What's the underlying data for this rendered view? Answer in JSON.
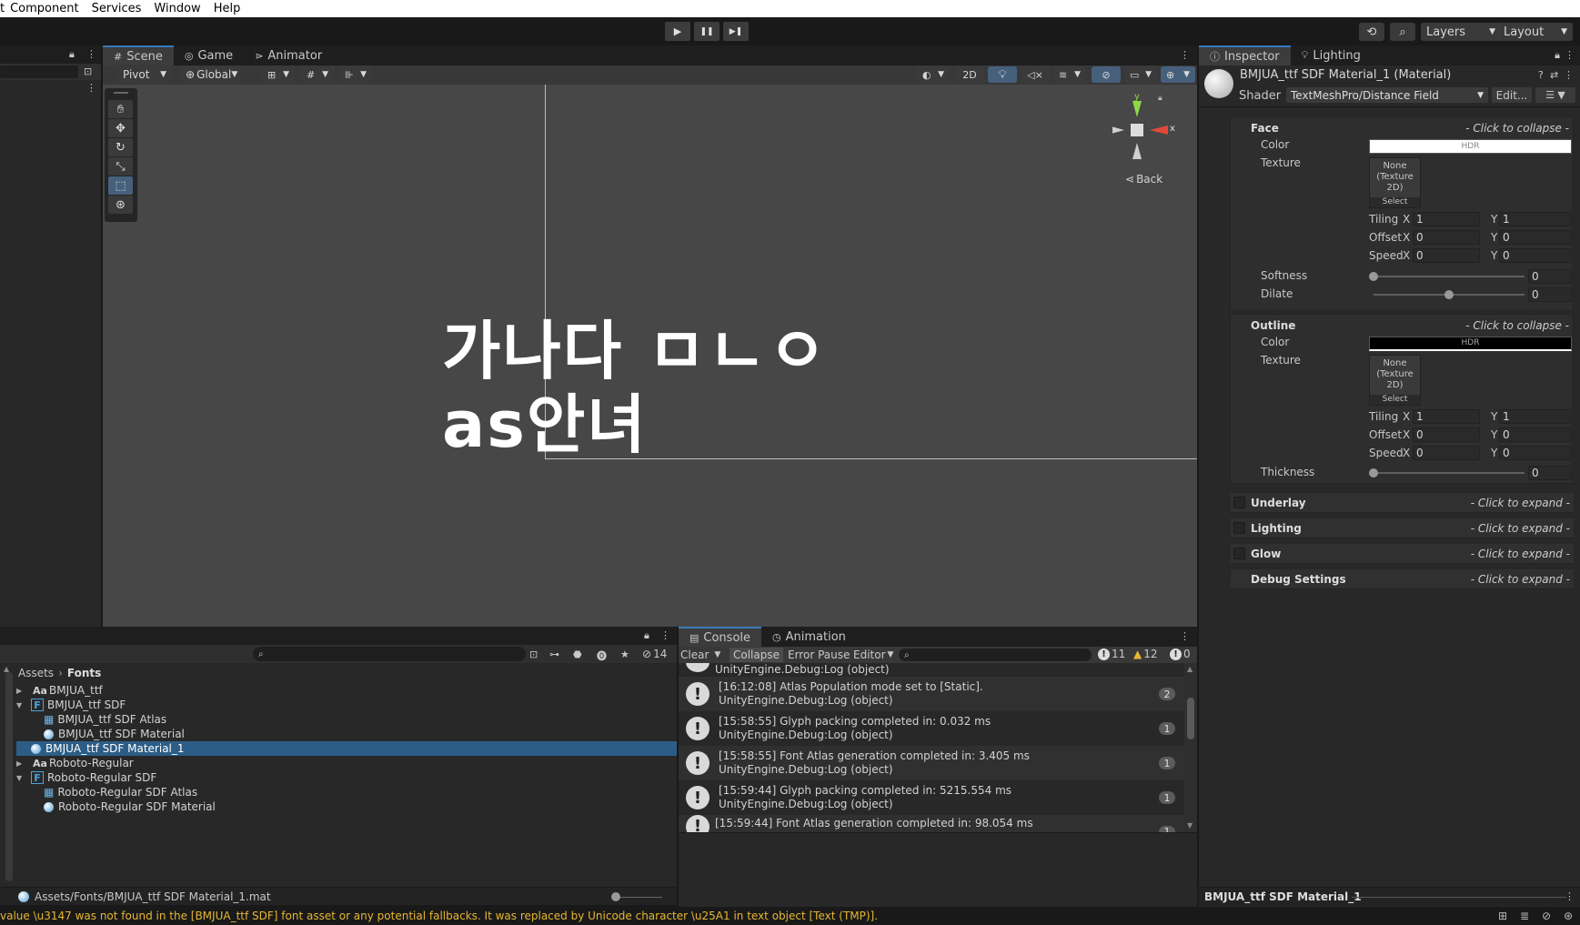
{
  "menu": [
    "Component",
    "Services",
    "Window",
    "Help"
  ],
  "toolbar": {
    "play": "▶",
    "pause": "❚❚",
    "step": "▶❚",
    "layers_label": "Layers",
    "layout_label": "Layout"
  },
  "scene_panel": {
    "tabs": [
      "Scene",
      "Game",
      "Animator"
    ],
    "pivot_label": "Pivot",
    "global_label": "Global",
    "mode_2d": "2D",
    "gizmo_back_label": "Back",
    "gizmo_y": "y",
    "gizmo_x": "x",
    "scene_text_line1": "가나다 ㅁㄴㅇ",
    "scene_text_line2": "as안녀"
  },
  "inspector": {
    "tabs": [
      "Inspector",
      "Lighting"
    ],
    "material_title": "BMJUA_ttf SDF Material_1 (Material)",
    "shader_label": "Shader",
    "shader_value": "TextMeshPro/Distance Field",
    "edit_button": "Edit...",
    "face": {
      "title": "Face",
      "collapse_hint": "- Click to collapse -",
      "color_label": "Color",
      "hdr_label": "HDR",
      "texture_label": "Texture",
      "texture_none": "None (Texture 2D)",
      "select_label": "Select",
      "tiling_label": "Tiling",
      "offset_label": "Offset",
      "speed_label": "Speed",
      "x": "X",
      "y": "Y",
      "tiling_x": "1",
      "tiling_y": "1",
      "offset_x": "0",
      "offset_y": "0",
      "speed_x": "0",
      "speed_y": "0",
      "softness_label": "Softness",
      "softness_value": "0",
      "dilate_label": "Dilate",
      "dilate_value": "0"
    },
    "outline": {
      "title": "Outline",
      "collapse_hint": "- Click to collapse -",
      "color_label": "Color",
      "hdr_label": "HDR",
      "texture_label": "Texture",
      "texture_none": "None (Texture 2D)",
      "select_label": "Select",
      "tiling_label": "Tiling",
      "offset_label": "Offset",
      "speed_label": "Speed",
      "x": "X",
      "y": "Y",
      "tiling_x": "1",
      "tiling_y": "1",
      "offset_x": "0",
      "offset_y": "0",
      "speed_x": "0",
      "speed_y": "0",
      "thickness_label": "Thickness",
      "thickness_value": "0"
    },
    "underlay": {
      "title": "Underlay",
      "hint": "- Click to expand -"
    },
    "lighting": {
      "title": "Lighting",
      "hint": "- Click to expand -"
    },
    "glow": {
      "title": "Glow",
      "hint": "- Click to expand -"
    },
    "debug": {
      "title": "Debug Settings",
      "hint": "- Click to expand -"
    },
    "footer_label": "BMJUA_ttf SDF Material_1"
  },
  "project": {
    "hidden_count": "14",
    "breadcrumb_root": "Assets",
    "breadcrumb_leaf": "Fonts",
    "items": [
      {
        "label": "BMJUA_ttf",
        "badge": "Aa"
      },
      {
        "label": "BMJUA_ttf SDF",
        "badge": "F"
      },
      {
        "label": "BMJUA_ttf SDF Atlas"
      },
      {
        "label": "BMJUA_ttf SDF Material"
      },
      {
        "label": "BMJUA_ttf SDF Material_1"
      },
      {
        "label": "Roboto-Regular",
        "badge": "Aa"
      },
      {
        "label": "Roboto-Regular SDF",
        "badge": "F"
      },
      {
        "label": "Roboto-Regular SDF Atlas"
      },
      {
        "label": "Roboto-Regular SDF Material"
      }
    ],
    "footer_path": "Assets/Fonts/BMJUA_ttf SDF Material_1.mat"
  },
  "console": {
    "tabs": [
      "Console",
      "Animation"
    ],
    "clear_label": "Clear",
    "collapse_label": "Collapse",
    "error_pause_label": "Error Pause",
    "editor_label": "Editor",
    "info_count": "11",
    "warn_count": "12",
    "error_count": "0",
    "partial_top": "UnityEngine.Debug:Log (object)",
    "logs": [
      {
        "line1": "[16:12:08] Atlas Population mode set to [Static].",
        "line2": "UnityEngine.Debug:Log (object)",
        "count": "2"
      },
      {
        "line1": "[15:58:55] Glyph packing completed in: 0.032 ms",
        "line2": "UnityEngine.Debug:Log (object)",
        "count": "1"
      },
      {
        "line1": "[15:58:55] Font Atlas generation completed in: 3.405 ms",
        "line2": "UnityEngine.Debug:Log (object)",
        "count": "1"
      },
      {
        "line1": "[15:59:44] Glyph packing completed in: 5215.554 ms",
        "line2": "UnityEngine.Debug:Log (object)",
        "count": "1"
      },
      {
        "line1": "[15:59:44] Font Atlas generation completed in: 98.054 ms",
        "line2": "",
        "count": "1"
      }
    ]
  },
  "status_message": "value \\u3147 was not found in the [BMJUA_ttf SDF] font asset or any potential fallbacks. It was replaced by Unicode character \\u25A1 in text object [Text (TMP)].",
  "colors": {
    "accent": "#3a79bb",
    "selection": "#2c5d87",
    "warning": "#e6b733",
    "scene_bg": "#474747"
  }
}
